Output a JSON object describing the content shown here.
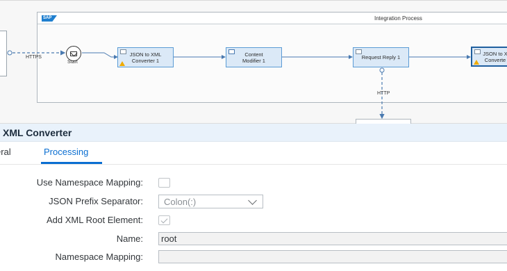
{
  "canvas": {
    "pool_title": "Integration Process",
    "logo_text": "SAP",
    "sender_connection_label": "HTTPS",
    "receiver_connection_label": "HTTP",
    "start_label": "Start",
    "nodes": {
      "json_to_xml_1": "JSON to XML\nConverter 1",
      "content_modifier": "Content\nModifier 1",
      "request_reply": "Request Reply 1",
      "json_to_xml_2": "JSON to X\nConverte"
    }
  },
  "panel": {
    "title": "XML Converter",
    "tabs": {
      "general": "eral",
      "processing": "Processing"
    },
    "fields": {
      "use_namespace_mapping": {
        "label": "Use Namespace Mapping:",
        "checked": false
      },
      "json_prefix_separator": {
        "label": "JSON Prefix Separator:",
        "value": "Colon(:)"
      },
      "add_xml_root_element": {
        "label": "Add XML Root Element:",
        "checked": true
      },
      "name": {
        "label": "Name:",
        "value": "root"
      },
      "namespace_mapping": {
        "label": "Namespace Mapping:",
        "value": ""
      }
    }
  },
  "colors": {
    "accent": "#0a6ed1",
    "node_fill": "#dbe9f7",
    "node_border": "#5b9bd5",
    "warning": "#f0ab00",
    "panel_header": "#e9f2fb"
  }
}
